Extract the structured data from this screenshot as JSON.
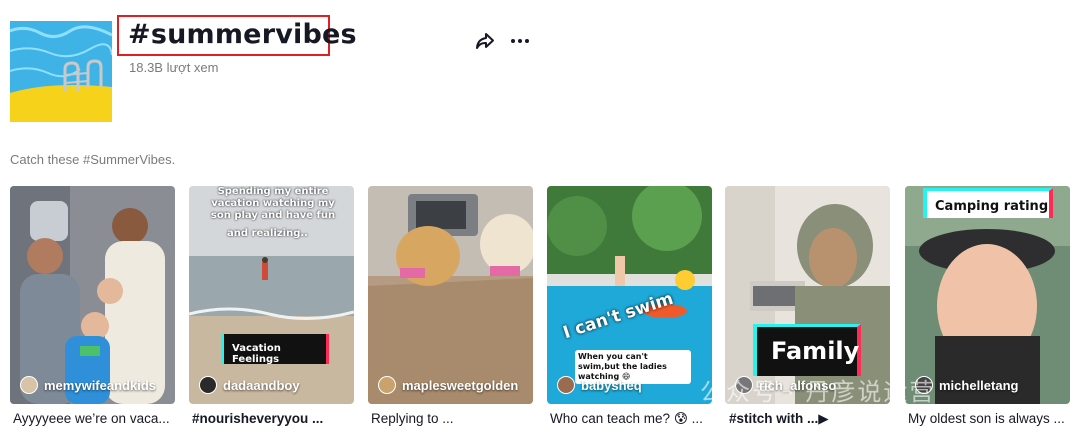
{
  "hashtag": {
    "title": "#summervibes",
    "views": "18.3B lượt xem"
  },
  "actions": {
    "share_icon": "share-icon",
    "more_icon": "more-icon"
  },
  "description": "Catch these #SummerVibes.",
  "videos": [
    {
      "author": "memywifeandkids",
      "caption": "Ayyyyeee we’re on vaca..."
    },
    {
      "author": "dadaandboy",
      "caption": "#nourisheveryyou ...",
      "overlay_top": "Spending my entire vacation watching my son play and have fun",
      "overlay_mid": "and realizing..",
      "overlay_tag": "Vacation Feelings"
    },
    {
      "author": "maplesweetgolden",
      "caption": "Replying to ..."
    },
    {
      "author": "babysheq",
      "caption": "Who can teach me? 😰 ...",
      "overlay_big": "I can't swim",
      "overlay_small": "When you can't swim,but the ladies watching 😄"
    },
    {
      "author": "rich_alfonso",
      "caption": "#stitch with ...▶",
      "overlay_tag": "Family"
    },
    {
      "author": "michelletang",
      "caption": "My oldest son is always ...",
      "overlay_tag": "Camping rating"
    }
  ],
  "watermark": "公众号 · 丹彦说运营",
  "colors": {
    "accent_red": "#e02020",
    "text": "#161823",
    "muted": "#7a7b81"
  }
}
